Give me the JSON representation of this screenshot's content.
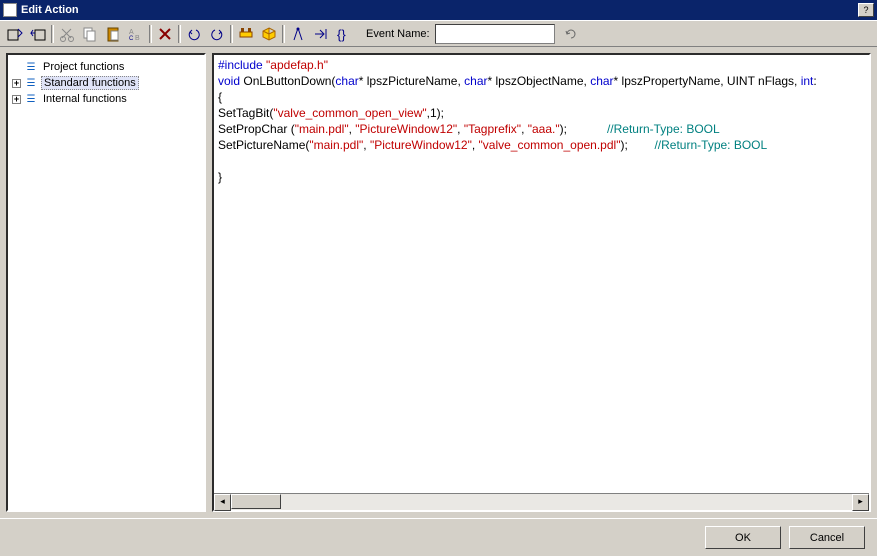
{
  "window": {
    "title": "Edit Action"
  },
  "toolbar": {
    "event_name_label": "Event Name:",
    "event_name_value": ""
  },
  "tree": {
    "items": [
      {
        "expander": "",
        "label": "Project functions"
      },
      {
        "expander": "+",
        "label": "Standard functions",
        "selected": true
      },
      {
        "expander": "+",
        "label": "Internal functions"
      }
    ]
  },
  "code": {
    "line1_pre": "#include",
    "line1_str": "\"apdefap.h\"",
    "line2_a": "void ",
    "line2_b": "OnLButtonDown(",
    "line2_c": "char",
    "line2_d": "* lpszPictureName, ",
    "line2_e": "char",
    "line2_f": "* lpszObjectName, ",
    "line2_g": "char",
    "line2_h": "* lpszPropertyName, UINT nFlags, ",
    "line2_i": "int",
    "line2_j": ":",
    "line3": "{",
    "line4_a": "SetTagBit(",
    "line4_b": "\"valve_common_open_view\"",
    "line4_c": ",1);",
    "line5_a": "SetPropChar (",
    "line5_b": "\"main.pdl\"",
    "line5_c": ", ",
    "line5_d": "\"PictureWindow12\"",
    "line5_e": ", ",
    "line5_f": "\"Tagprefix\"",
    "line5_g": ", ",
    "line5_h": "\"aaa.\"",
    "line5_i": ");            ",
    "line5_j": "//Return-Type: BOOL ",
    "line6_a": "SetPictureName(",
    "line6_b": "\"main.pdl\"",
    "line6_c": ", ",
    "line6_d": "\"PictureWindow12\"",
    "line6_e": ", ",
    "line6_f": "\"valve_common_open.pdl\"",
    "line6_g": ");        ",
    "line6_h": "//Return-Type: BOOL ",
    "line8": "}"
  },
  "footer": {
    "ok": "OK",
    "cancel": "Cancel"
  }
}
